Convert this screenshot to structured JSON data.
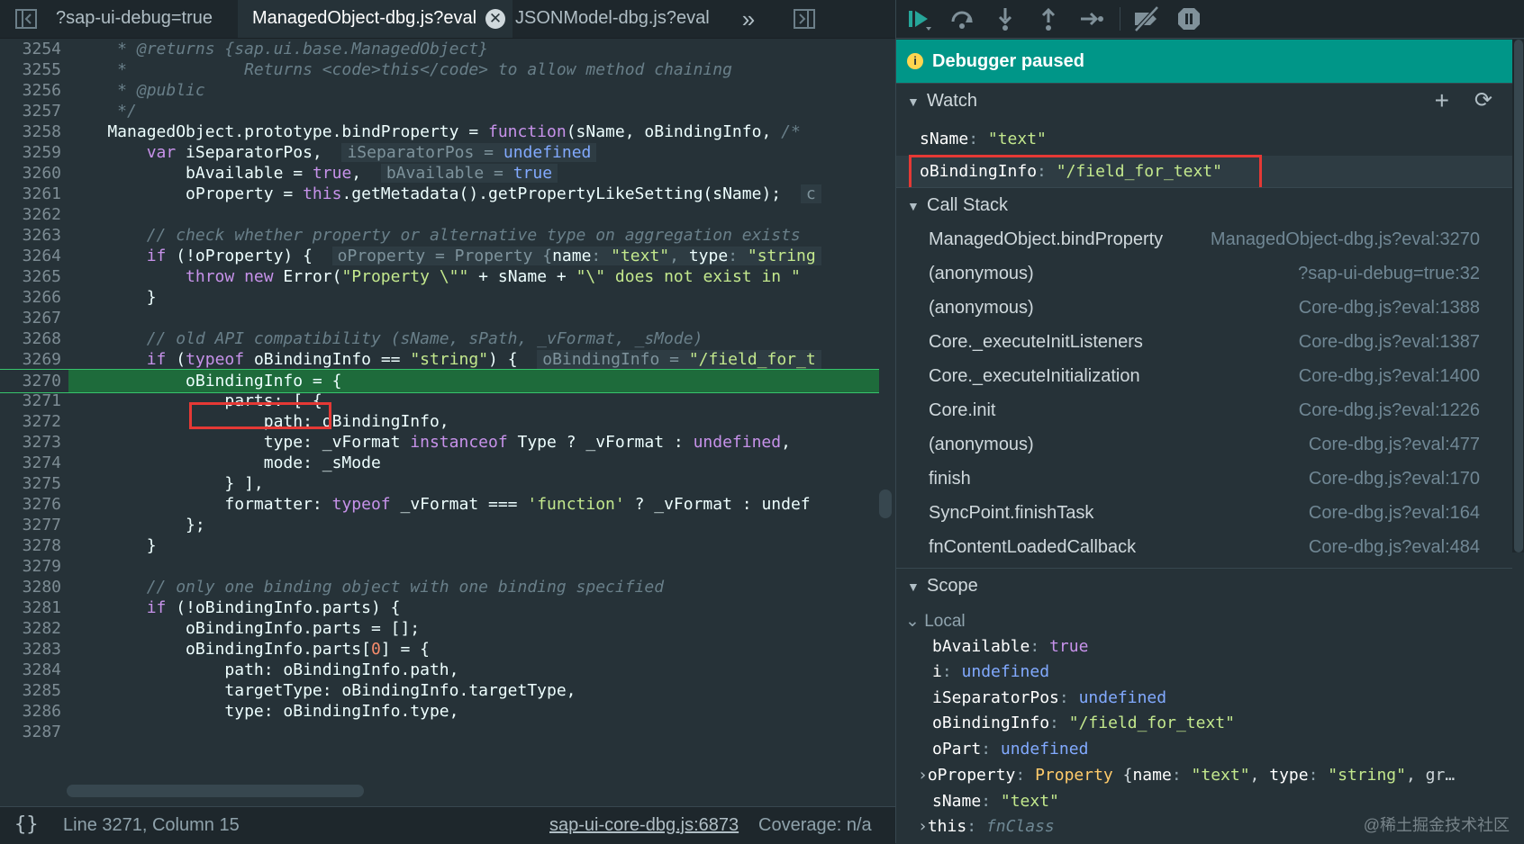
{
  "tabs": {
    "items": [
      {
        "label": "?sap-ui-debug=true"
      },
      {
        "label": "ManagedObject-dbg.js?eval"
      },
      {
        "label": "JSONModel-dbg.js?eval"
      }
    ],
    "more": "»"
  },
  "code": {
    "l3254": {
      "n": "3254",
      "c": "     * @returns {sap.ui.base.ManagedObject}"
    },
    "l3255": {
      "n": "3255",
      "c": "     *            Returns <code>this</code> to allow method chaining"
    },
    "l3256": {
      "n": "3256",
      "c": "     * @public"
    },
    "l3257": {
      "n": "3257",
      "c": "     */"
    },
    "l3258": {
      "n": "3258",
      "a": "    ManagedObject.prototype.bindProperty = ",
      "kw": "function",
      "b": "(sName, oBindingInfo, ",
      "cm": "/*"
    },
    "l3259": {
      "n": "3259",
      "i": "        ",
      "kw": "var",
      "a": " iSeparatorPos,",
      "in1": "iSeparatorPos = ",
      "in1v": "undefined"
    },
    "l3260": {
      "n": "3260",
      "a": "            bAvailable = ",
      "kw": "true",
      "b": ",",
      "in1": "bAvailable = ",
      "in1v": "true"
    },
    "l3261": {
      "n": "3261",
      "a": "            oProperty = ",
      "kw": "this",
      "b": ".getMetadata().getPropertyLikeSetting(sName);",
      "in1": "c"
    },
    "l3262": {
      "n": "3262"
    },
    "l3263": {
      "n": "3263",
      "c": "        // check whether property or alternative type on aggregation exists"
    },
    "l3264": {
      "n": "3264",
      "i": "        ",
      "kw": "if",
      "a": " (!oProperty) {",
      "in1": "oProperty = Property {",
      "in1k": "name",
      "in1s": "\"text\"",
      "in1k2": "type",
      "in1s2": "\"string"
    },
    "l3265": {
      "n": "3265",
      "i": "            ",
      "kw": "throw",
      "kw2": "new",
      "a": " Error(",
      "s": "\"Property \\\"\"",
      "b": " + sName + ",
      "s2": "\"\\\" does not exist in \""
    },
    "l3266": {
      "n": "3266",
      "a": "        }"
    },
    "l3267": {
      "n": "3267"
    },
    "l3268": {
      "n": "3268",
      "c": "        // old API compatibility (sName, sPath, _vFormat, _sMode)"
    },
    "l3269": {
      "n": "3269",
      "i": "        ",
      "kw": "if",
      "a": " (",
      "kw2": "typeof",
      "b": " oBindingInfo == ",
      "s": "\"string\"",
      "b2": ") {",
      "in1": "oBindingInfo = ",
      "in1s": "\"/field_for_t"
    },
    "l3270": {
      "n": "3270",
      "i": "            ",
      "a": "oBindingInfo",
      "b": " = {"
    },
    "l3271": {
      "n": "3271",
      "a": "                parts: [ {"
    },
    "l3272": {
      "n": "3272",
      "a": "                    path: oBindingInfo,"
    },
    "l3273": {
      "n": "3273",
      "a": "                    type: _vFormat ",
      "kw": "instanceof",
      "b": " Type ? _vFormat : ",
      "kw2": "undefined",
      "b2": ","
    },
    "l3274": {
      "n": "3274",
      "a": "                    mode: _sMode"
    },
    "l3275": {
      "n": "3275",
      "a": "                } ],"
    },
    "l3276": {
      "n": "3276",
      "a": "                formatter: ",
      "kw": "typeof",
      "b": " _vFormat === ",
      "s": "'function'",
      "b2": " ? _vFormat : undef"
    },
    "l3277": {
      "n": "3277",
      "a": "            };"
    },
    "l3278": {
      "n": "3278",
      "a": "        }"
    },
    "l3279": {
      "n": "3279"
    },
    "l3280": {
      "n": "3280",
      "c": "        // only one binding object with one binding specified"
    },
    "l3281": {
      "n": "3281",
      "i": "        ",
      "kw": "if",
      "a": " (!oBindingInfo.parts) {"
    },
    "l3282": {
      "n": "3282",
      "a": "            oBindingInfo.parts = [];"
    },
    "l3283": {
      "n": "3283",
      "a": "            oBindingInfo.parts[",
      "num": "0",
      "b": "] = {"
    },
    "l3284": {
      "n": "3284",
      "a": "                path: oBindingInfo.path,"
    },
    "l3285": {
      "n": "3285",
      "a": "                targetType: oBindingInfo.targetType,"
    },
    "l3286": {
      "n": "3286",
      "a": "                type: oBindingInfo.type,"
    },
    "l3287": {
      "n": "3287"
    }
  },
  "status": {
    "braces": "{}",
    "position": "Line 3271, Column 15",
    "source_link": "sap-ui-core-dbg.js:6873",
    "coverage": "Coverage: n/a"
  },
  "debugger": {
    "paused_label": "Debugger paused",
    "info_glyph": "i",
    "watch_title": "Watch",
    "watch": [
      {
        "name": "sName",
        "value": "\"text\""
      },
      {
        "name": "oBindingInfo",
        "value": "\"/field_for_text\""
      }
    ],
    "callstack_title": "Call Stack",
    "callstack": [
      {
        "fn": "ManagedObject.bindProperty",
        "loc": "ManagedObject-dbg.js?eval:3270"
      },
      {
        "fn": "(anonymous)",
        "loc": "?sap-ui-debug=true:32"
      },
      {
        "fn": "(anonymous)",
        "loc": "Core-dbg.js?eval:1388"
      },
      {
        "fn": "Core._executeInitListeners",
        "loc": "Core-dbg.js?eval:1387"
      },
      {
        "fn": "Core._executeInitialization",
        "loc": "Core-dbg.js?eval:1400"
      },
      {
        "fn": "Core.init",
        "loc": "Core-dbg.js?eval:1226"
      },
      {
        "fn": "(anonymous)",
        "loc": "Core-dbg.js?eval:477"
      },
      {
        "fn": "finish",
        "loc": "Core-dbg.js?eval:170"
      },
      {
        "fn": "SyncPoint.finishTask",
        "loc": "Core-dbg.js?eval:164"
      },
      {
        "fn": "fnContentLoadedCallback",
        "loc": "Core-dbg.js?eval:484"
      }
    ],
    "scope_title": "Scope",
    "local_title": "Local",
    "scope": {
      "bAvailable": {
        "k": "bAvailable",
        "v": "true"
      },
      "i": {
        "k": "i",
        "v": "undefined"
      },
      "iSeparatorPos": {
        "k": "iSeparatorPos",
        "v": "undefined"
      },
      "oBindingInfo": {
        "k": "oBindingInfo",
        "v": "\"/field_for_text\""
      },
      "oPart": {
        "k": "oPart",
        "v": "undefined"
      },
      "oProperty": {
        "k": "oProperty",
        "cls": "Property",
        "brace": "{",
        "k1": "name",
        "v1": "\"text\"",
        "k2": "type",
        "v2": "\"string\"",
        "tail": ", gr…"
      },
      "sName": {
        "k": "sName",
        "v": "\"text\""
      },
      "this": {
        "k": "this",
        "v": "fnClass"
      }
    }
  },
  "watermark": "@稀土掘金技术社区",
  "colors": {
    "accent": "#009688",
    "current_line": "#1e6b3b",
    "highlight_box": "#e53935"
  }
}
